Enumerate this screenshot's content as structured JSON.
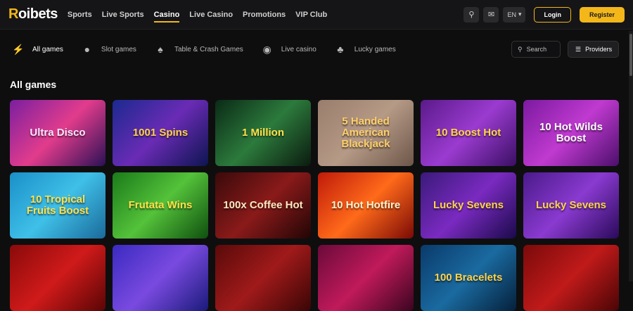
{
  "brand": {
    "logo_first": "R",
    "logo_rest": "oibets"
  },
  "nav": [
    {
      "label": "Sports",
      "active": false
    },
    {
      "label": "Live Sports",
      "active": false
    },
    {
      "label": "Casino",
      "active": true
    },
    {
      "label": "Live Casino",
      "active": false
    },
    {
      "label": "Promotions",
      "active": false
    },
    {
      "label": "VIP Club",
      "active": false
    }
  ],
  "topbar": {
    "language": "EN",
    "login_label": "Login",
    "register_label": "Register",
    "icons": [
      "search-icon",
      "chat-icon"
    ]
  },
  "categories": [
    {
      "label": "All games",
      "icon": "lightning-icon",
      "active": true
    },
    {
      "label": "Slot games",
      "icon": "cherry-icon",
      "active": false
    },
    {
      "label": "Table & Crash Games",
      "icon": "cards-icon",
      "active": false
    },
    {
      "label": "Live casino",
      "icon": "chip-icon",
      "active": false
    },
    {
      "label": "Lucky games",
      "icon": "clover-icon",
      "active": false
    }
  ],
  "search": {
    "placeholder": "Search"
  },
  "providers_label": "Providers",
  "section_title": "All games",
  "colors": {
    "accent": "#f3b71a",
    "background": "#0e0e0f"
  },
  "games": [
    {
      "title": "Ultra Disco",
      "bg": "linear-gradient(135deg,#7a1fa0,#e23c8c 50%,#2a1155)",
      "fg": "#fde6ff"
    },
    {
      "title": "1001 Spins",
      "bg": "linear-gradient(135deg,#1b2a8f,#6a2bb5 50%,#0d1550)",
      "fg": "#ffd34a"
    },
    {
      "title": "1 Million",
      "bg": "linear-gradient(135deg,#0a2a16,#2c7a3c 50%,#0b1b0f)",
      "fg": "#ffe14a"
    },
    {
      "title": "5 Handed American Blackjack",
      "bg": "linear-gradient(135deg,#9a7d6c,#b59a86 50%,#6d5649)",
      "fg": "#ffcf6a"
    },
    {
      "title": "10 Boost Hot",
      "bg": "linear-gradient(135deg,#5a1a8a,#9b3bd0 50%,#3a0f63)",
      "fg": "#ffd54a"
    },
    {
      "title": "10 Hot Wilds Boost",
      "bg": "linear-gradient(135deg,#7b1aa0,#c03ad0 50%,#4b0f6b)",
      "fg": "#ffffff"
    },
    {
      "title": "10 Tropical Fruits Boost",
      "bg": "linear-gradient(135deg,#1a8fc8,#3fc0e8 50%,#1a6a9a)",
      "fg": "#ffe14a"
    },
    {
      "title": "Frutata Wins",
      "bg": "linear-gradient(135deg,#1a7a1a,#54c23a 50%,#0f4f0f)",
      "fg": "#ffe14a"
    },
    {
      "title": "100x Coffee Hot",
      "bg": "linear-gradient(135deg,#3a0a0a,#8a1a1a 50%,#220505)",
      "fg": "#ffe8c0"
    },
    {
      "title": "10 Hot Hotfire",
      "bg": "linear-gradient(135deg,#c01a0a,#ff6a1a 50%,#7a0a05)",
      "fg": "#fff3d0"
    },
    {
      "title": "Lucky Sevens",
      "bg": "linear-gradient(135deg,#3a1a7a,#7a2ac0 50%,#1a0a4a)",
      "fg": "#ffd34a"
    },
    {
      "title": "Lucky Sevens",
      "bg": "linear-gradient(135deg,#4a1a8a,#8a3ad0 50%,#2a0a5a)",
      "fg": "#ffd34a"
    },
    {
      "title": "",
      "bg": "linear-gradient(135deg,#8a0a0a,#d01a1a 50%,#5a0505)",
      "fg": "#ffffff"
    },
    {
      "title": "",
      "bg": "linear-gradient(135deg,#3a2ac0,#7a4ae0 50%,#1a1a7a)",
      "fg": "#ffffff"
    },
    {
      "title": "",
      "bg": "linear-gradient(135deg,#5a0a0a,#a01a1a 50%,#3a0505)",
      "fg": "#ffffff"
    },
    {
      "title": "",
      "bg": "linear-gradient(135deg,#6a0a3a,#c01a5a 50%,#3a0520)",
      "fg": "#ffffff"
    },
    {
      "title": "100 Bracelets",
      "bg": "linear-gradient(135deg,#0a3a6a,#1a6aa0 50%,#05203a)",
      "fg": "#ffd34a"
    },
    {
      "title": "",
      "bg": "linear-gradient(135deg,#7a0a0a,#c01a1a 50%,#4a0505)",
      "fg": "#ffffff"
    }
  ]
}
